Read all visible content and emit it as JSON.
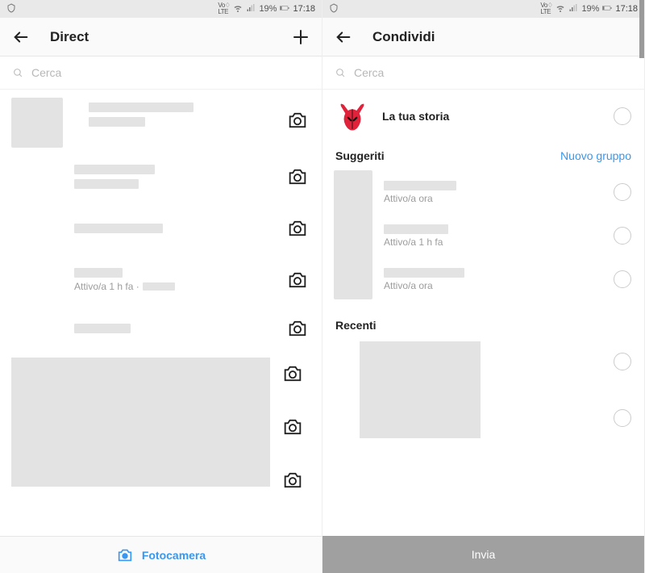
{
  "status": {
    "carrier": "VoLTE",
    "battery_pct": "19%",
    "time": "17:18"
  },
  "left": {
    "title": "Direct",
    "search_placeholder": "Cerca",
    "active_label": "Attivo/a 1 h fa  ·",
    "bottom_label": "Fotocamera"
  },
  "right": {
    "title": "Condividi",
    "search_placeholder": "Cerca",
    "story_label": "La tua storia",
    "section_suggested": "Suggeriti",
    "new_group": "Nuovo gruppo",
    "suggested": [
      {
        "status": "Attivo/a ora"
      },
      {
        "status": "Attivo/a 1 h fa"
      },
      {
        "status": "Attivo/a ora"
      }
    ],
    "section_recent": "Recenti",
    "send_label": "Invia"
  }
}
